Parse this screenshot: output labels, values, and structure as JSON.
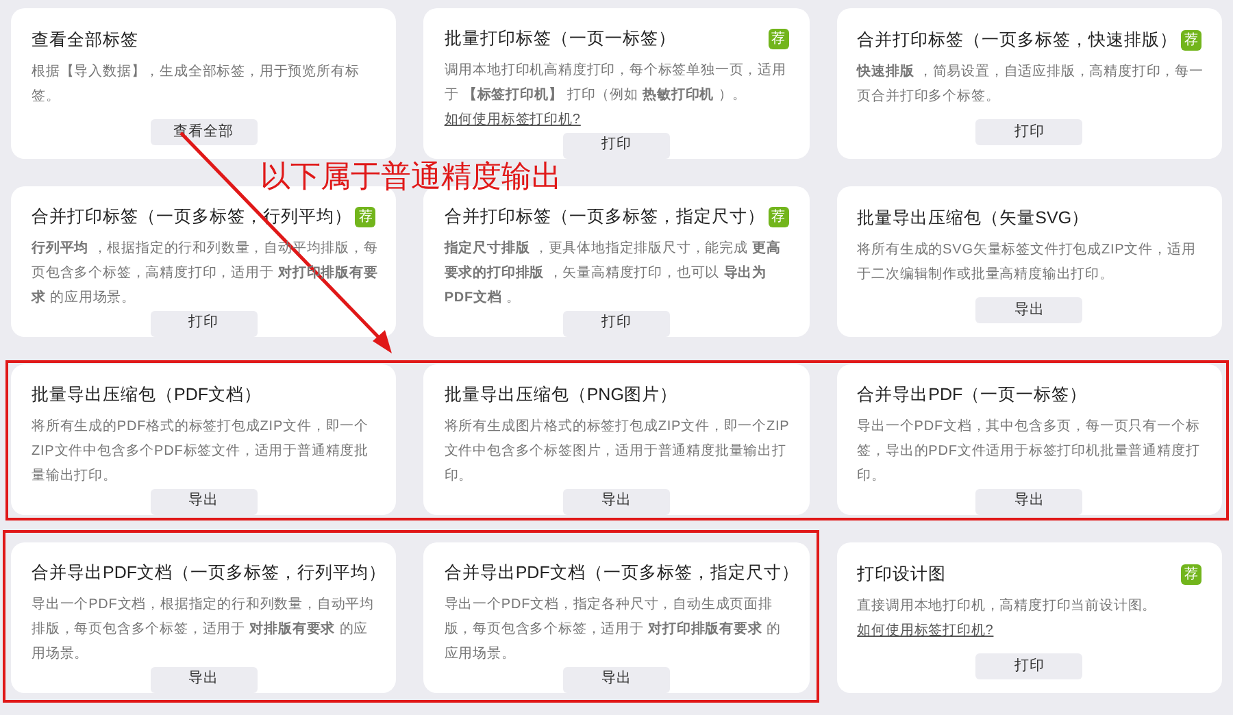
{
  "cards": [
    {
      "title": "查看全部标签",
      "recommended": false,
      "description": "根据【导入数据】，生成全部标签，用于预览所有标签。",
      "button": "查看全部"
    },
    {
      "title": "批量打印标签（一页一标签）",
      "recommended": true,
      "badge": "荐",
      "description": "调用本地打印机高精度打印，每个标签单独一页，适用于 **【标签打印机】** 打印（例如 **热敏打印机** ）。",
      "link": "如何使用标签打印机?",
      "button": "打印"
    },
    {
      "title": "合并打印标签（一页多标签，快速排版）",
      "recommended": true,
      "badge": "荐",
      "description": "**快速排版** ，简易设置，自适应排版，高精度打印，每一页合并打印多个标签。",
      "button": "打印"
    },
    {
      "title": "合并打印标签（一页多标签，行列平均）",
      "recommended": true,
      "badge": "荐",
      "description": "**行列平均** ，根据指定的行和列数量，自动平均排版，每页包含多个标签，高精度打印，适用于 **对打印排版有要求** 的应用场景。",
      "button": "打印"
    },
    {
      "title": "合并打印标签（一页多标签，指定尺寸）",
      "recommended": true,
      "badge": "荐",
      "description": "**指定尺寸排版** ，更具体地指定排版尺寸，能完成 **更高要求的打印排版** ，矢量高精度打印，也可以 **导出为PDF文档** 。",
      "button": "打印"
    },
    {
      "title": "批量导出压缩包（矢量SVG）",
      "recommended": false,
      "description": "将所有生成的SVG矢量标签文件打包成ZIP文件，适用于二次编辑制作或批量高精度输出打印。",
      "button": "导出"
    },
    {
      "title": "批量导出压缩包（PDF文档）",
      "recommended": false,
      "description": "将所有生成的PDF格式的标签打包成ZIP文件，即一个ZIP文件中包含多个PDF标签文件，适用于普通精度批量输出打印。",
      "button": "导出"
    },
    {
      "title": "批量导出压缩包（PNG图片）",
      "recommended": false,
      "description": "将所有生成图片格式的标签打包成ZIP文件，即一个ZIP文件中包含多个标签图片，适用于普通精度批量输出打印。",
      "button": "导出"
    },
    {
      "title": "合并导出PDF（一页一标签）",
      "recommended": false,
      "description": "导出一个PDF文档，其中包含多页，每一页只有一个标签，导出的PDF文件适用于标签打印机批量普通精度打印。",
      "button": "导出"
    },
    {
      "title": "合并导出PDF文档（一页多标签，行列平均）",
      "recommended": false,
      "description": "导出一个PDF文档，根据指定的行和列数量，自动平均排版，每页包含多个标签，适用于 **对排版有要求** 的应用场景。",
      "button": "导出"
    },
    {
      "title": "合并导出PDF文档（一页多标签，指定尺寸）",
      "recommended": false,
      "description": "导出一个PDF文档，指定各种尺寸，自动生成页面排版，每页包含多个标签，适用于 **对打印排版有要求** 的应用场景。",
      "button": "导出"
    },
    {
      "title": "打印设计图",
      "recommended": true,
      "badge": "荐",
      "description": "直接调用本地打印机，高精度打印当前设计图。",
      "link": "如何使用标签打印机?",
      "button": "打印"
    }
  ],
  "annotation": {
    "label": "以下属于普通精度输出"
  }
}
